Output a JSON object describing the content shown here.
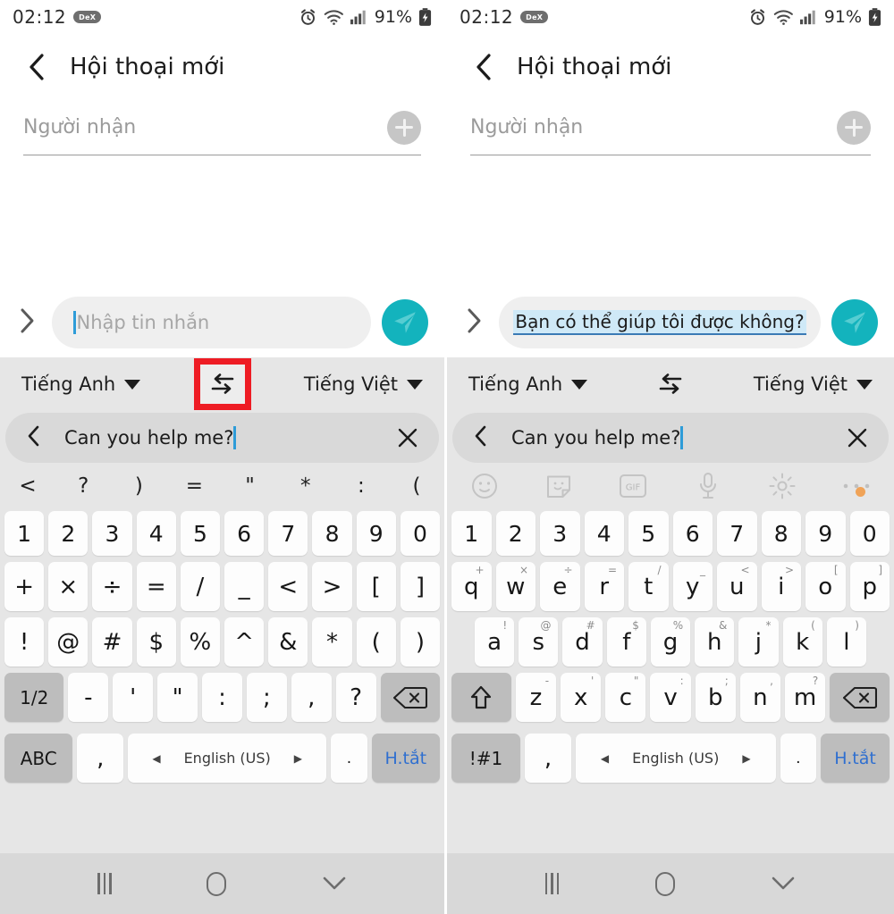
{
  "status_bar": {
    "time": "02:12",
    "dex_label": "DeX",
    "battery_percent": "91%",
    "icons": [
      "alarm-icon",
      "wifi-icon",
      "signal-icon",
      "battery-charging-icon"
    ]
  },
  "app_header": {
    "back_icon": "chevron-left-icon",
    "title": "Hội thoại mới"
  },
  "recipient": {
    "placeholder": "Người nhận",
    "add_icon": "plus-circle-icon"
  },
  "compose": {
    "expand_icon": "chevron-right-icon",
    "left_placeholder": "Nhập tin nhắn",
    "right_text": "Bạn có thể giúp tôi được không?",
    "send_icon": "send-icon",
    "send_color": "#13b3bd",
    "highlight_color": "#cfe9f7"
  },
  "translate_bar": {
    "source_lang": "Tiếng Anh",
    "target_lang": "Tiếng Việt",
    "swap_icon": "swap-horizontal-icon",
    "highlight_color": "#ee1c24"
  },
  "translate_input": {
    "back_icon": "chevron-left-icon",
    "text": "Can you help me?",
    "clear_icon": "close-icon"
  },
  "left_panel": {
    "suggestions": [
      "<",
      "?",
      ")",
      "=",
      "\"",
      "*",
      ":",
      "("
    ],
    "rows": [
      {
        "type": "num",
        "keys": [
          {
            "label": "1"
          },
          {
            "label": "2"
          },
          {
            "label": "3"
          },
          {
            "label": "4"
          },
          {
            "label": "5"
          },
          {
            "label": "6"
          },
          {
            "label": "7"
          },
          {
            "label": "8"
          },
          {
            "label": "9"
          },
          {
            "label": "0"
          }
        ]
      },
      {
        "type": "sym",
        "keys": [
          {
            "label": "+"
          },
          {
            "label": "×"
          },
          {
            "label": "÷"
          },
          {
            "label": "="
          },
          {
            "label": "/"
          },
          {
            "label": "_"
          },
          {
            "label": "<"
          },
          {
            "label": ">"
          },
          {
            "label": "["
          },
          {
            "label": "]"
          }
        ]
      },
      {
        "type": "sym",
        "keys": [
          {
            "label": "!"
          },
          {
            "label": "@"
          },
          {
            "label": "#"
          },
          {
            "label": "$"
          },
          {
            "label": "%"
          },
          {
            "label": "^"
          },
          {
            "label": "&"
          },
          {
            "label": "*"
          },
          {
            "label": "("
          },
          {
            "label": ")"
          }
        ]
      },
      {
        "type": "sym4",
        "keys": [
          {
            "label": "1/2",
            "mod": true
          },
          {
            "label": "-"
          },
          {
            "label": "'"
          },
          {
            "label": "\""
          },
          {
            "label": ":"
          },
          {
            "label": ";"
          },
          {
            "label": ","
          },
          {
            "label": "?"
          },
          {
            "label": "backspace-icon",
            "mod": true
          }
        ]
      }
    ],
    "bottom_row": {
      "switch_key": "ABC",
      "comma_key": ",",
      "space_label": "English (US)",
      "period_key": ".",
      "hide_key": "H.tắt"
    }
  },
  "right_panel": {
    "toolbar": [
      "emoji-icon",
      "sticker-icon",
      "gif-icon",
      "microphone-icon",
      "settings-icon",
      "more-icon"
    ],
    "rows": [
      {
        "type": "num",
        "keys": [
          {
            "label": "1"
          },
          {
            "label": "2"
          },
          {
            "label": "3"
          },
          {
            "label": "4"
          },
          {
            "label": "5"
          },
          {
            "label": "6"
          },
          {
            "label": "7"
          },
          {
            "label": "8"
          },
          {
            "label": "9"
          },
          {
            "label": "0"
          }
        ]
      },
      {
        "type": "qwerty",
        "keys": [
          {
            "label": "q",
            "sup": "+"
          },
          {
            "label": "w",
            "sup": "×"
          },
          {
            "label": "e",
            "sup": "÷"
          },
          {
            "label": "r",
            "sup": "="
          },
          {
            "label": "t",
            "sup": "/"
          },
          {
            "label": "y",
            "sup": "_"
          },
          {
            "label": "u",
            "sup": "<"
          },
          {
            "label": "i",
            "sup": ">"
          },
          {
            "label": "o",
            "sup": "["
          },
          {
            "label": "p",
            "sup": "]"
          }
        ]
      },
      {
        "type": "asdf",
        "keys": [
          {
            "label": "a",
            "sup": "!"
          },
          {
            "label": "s",
            "sup": "@"
          },
          {
            "label": "d",
            "sup": "#"
          },
          {
            "label": "f",
            "sup": "$"
          },
          {
            "label": "g",
            "sup": "%"
          },
          {
            "label": "h",
            "sup": "&"
          },
          {
            "label": "j",
            "sup": "*"
          },
          {
            "label": "k",
            "sup": "("
          },
          {
            "label": "l",
            "sup": ")"
          }
        ]
      },
      {
        "type": "zxcv",
        "keys": [
          {
            "label": "shift-icon",
            "mod": true
          },
          {
            "label": "z",
            "sup": "-"
          },
          {
            "label": "x",
            "sup": "'"
          },
          {
            "label": "c",
            "sup": "\""
          },
          {
            "label": "v",
            "sup": ":"
          },
          {
            "label": "b",
            "sup": ";"
          },
          {
            "label": "n",
            "sup": ","
          },
          {
            "label": "m",
            "sup": "?"
          },
          {
            "label": "backspace-icon",
            "mod": true
          }
        ]
      }
    ],
    "bottom_row": {
      "switch_key": "!#1",
      "comma_key": ",",
      "space_label": "English (US)",
      "period_key": ".",
      "hide_key": "H.tắt"
    }
  },
  "nav_bar": {
    "recents_icon": "recents-icon",
    "home_icon": "home-icon",
    "hide_keyboard_icon": "chevron-down-icon"
  }
}
